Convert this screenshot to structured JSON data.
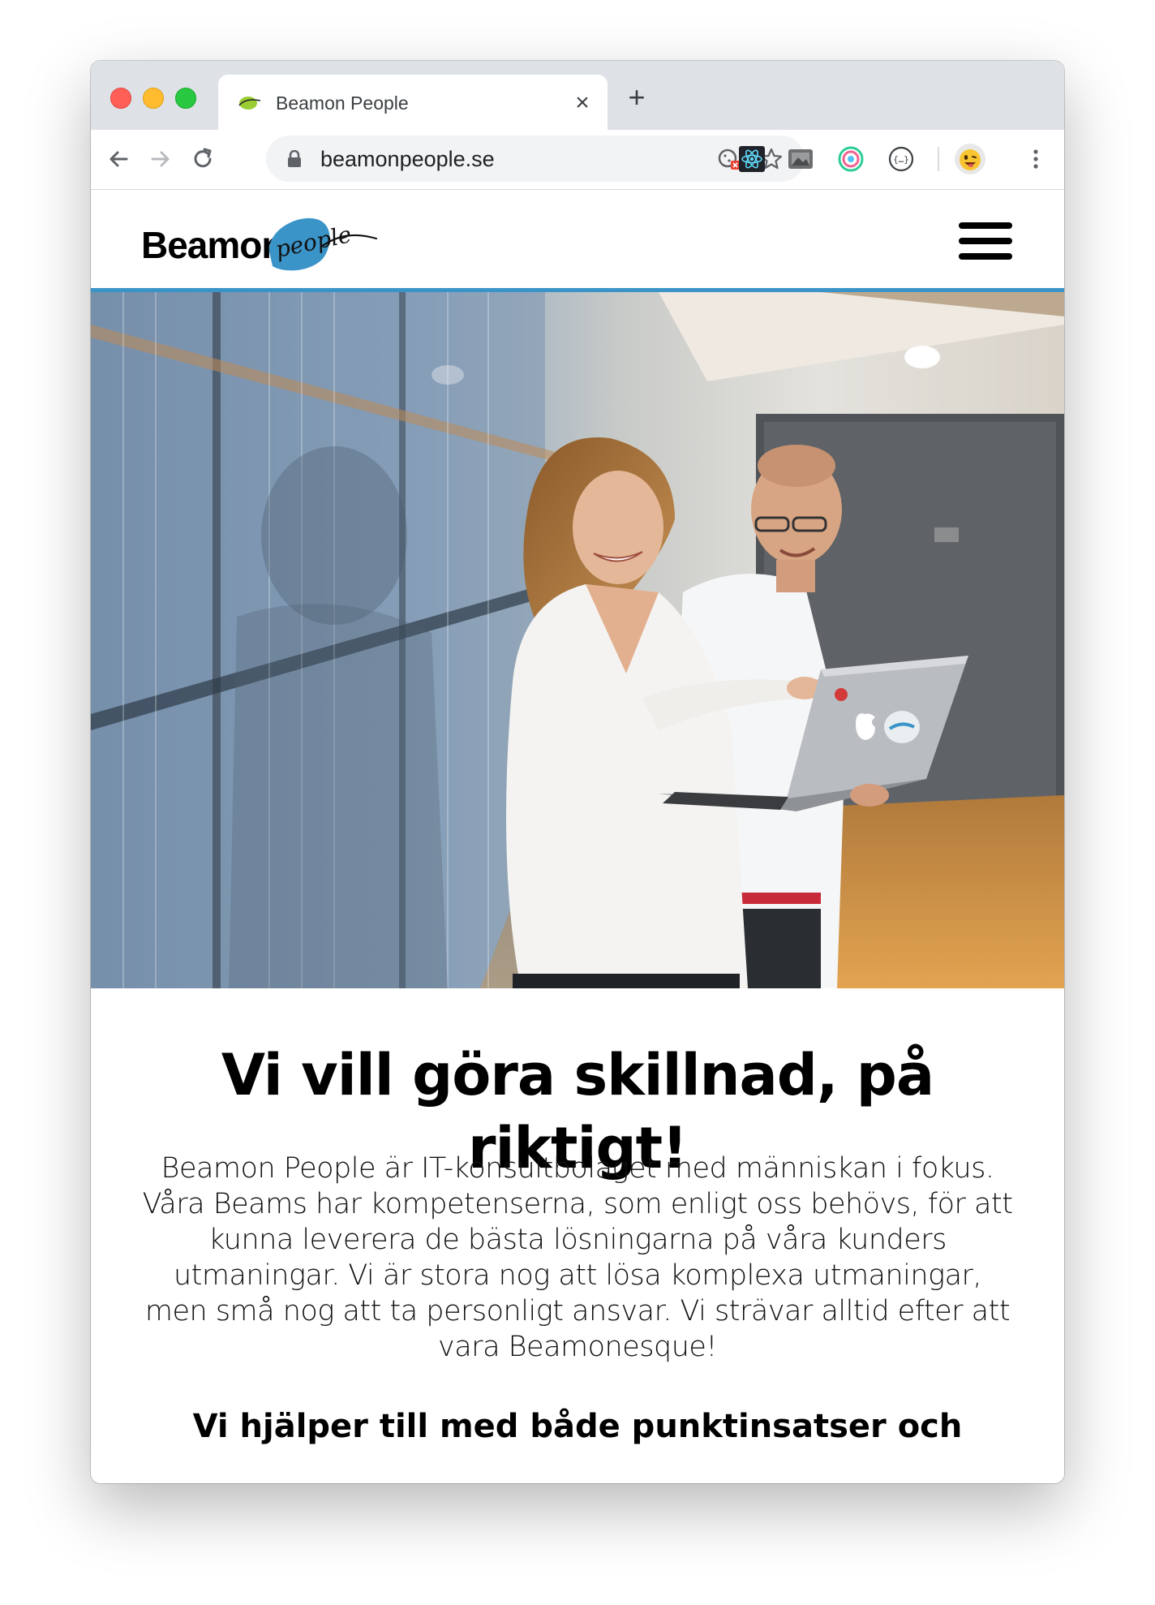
{
  "browser": {
    "tab_title": "Beamon People",
    "tab_close_glyph": "×",
    "new_tab_glyph": "+",
    "url": "beamonpeople.se",
    "icons": {
      "back": "back-arrow-icon",
      "forward": "forward-arrow-icon",
      "reload": "reload-icon",
      "lock": "lock-icon",
      "cookie": "cookie-blocked-icon",
      "star": "bookmark-star-icon",
      "extensions": [
        "react-devtools-icon",
        "screenshot-extension-icon",
        "color-picker-extension-icon",
        "json-viewer-icon"
      ],
      "profile": "profile-avatar-icon",
      "menu": "kebab-menu-icon"
    }
  },
  "site": {
    "logo_text": "Beamon",
    "logo_script": "people",
    "hero_alt": "Two colleagues smiling and pointing at a laptop in an office hallway",
    "headline": "Vi vill göra skillnad, på riktigt!",
    "intro": "Beamon People är IT-konsultbolaget med människan i fokus. Våra Beams har kompetenserna, som enligt oss behövs, för att kunna leverera de bästa lösningarna på våra kunders utmaningar. Vi är stora nog att lösa komplexa utmaningar, men små nog att ta personligt ansvar. Vi strävar alltid efter att vara Beamonesque!",
    "subhead": "Vi hjälper till med både punktinsatser och"
  },
  "colors": {
    "accent_blue": "#3a94c8",
    "header_border": "#3a94c8"
  }
}
